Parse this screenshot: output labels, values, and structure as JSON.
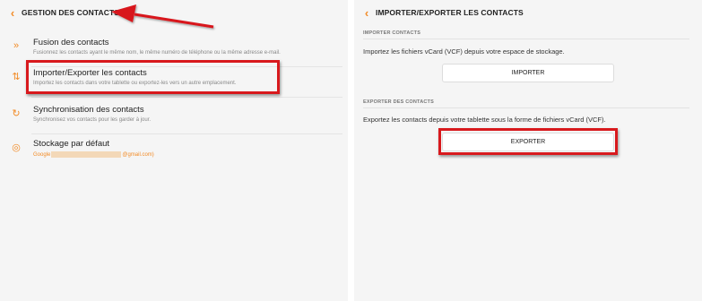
{
  "left": {
    "title": "GESTION DES CONTACTS",
    "items": [
      {
        "icon": "merge-icon",
        "glyph": "»",
        "label": "Fusion des contacts",
        "sub": "Fusionnez les contacts ayant le même nom, le même numéro de téléphone ou la même adresse e-mail."
      },
      {
        "icon": "import-export-icon",
        "glyph": "⇅",
        "label": "Importer/Exporter les contacts",
        "sub": "Importez les contacts dans votre tablette ou exportez-les vers un autre emplacement."
      },
      {
        "icon": "sync-icon",
        "glyph": "↻",
        "label": "Synchronisation des contacts",
        "sub": "Synchronisez vos contacts pour les garder à jour."
      },
      {
        "icon": "storage-icon",
        "glyph": "◎",
        "label": "Stockage par défaut",
        "sub_prefix": "Google",
        "sub_suffix": "@gmail.com)"
      }
    ]
  },
  "right": {
    "title": "IMPORTER/EXPORTER LES CONTACTS",
    "import_section": "IMPORTER CONTACTS",
    "import_desc": "Importez les fichiers vCard (VCF) depuis votre espace de stockage.",
    "import_button": "IMPORTER",
    "export_section": "EXPORTER DES CONTACTS",
    "export_desc": "Exportez les contacts depuis votre tablette sous la forme de fichiers vCard (VCF).",
    "export_button": "EXPORTER"
  },
  "colors": {
    "accent": "#f28c28",
    "highlight": "#d8191d"
  }
}
